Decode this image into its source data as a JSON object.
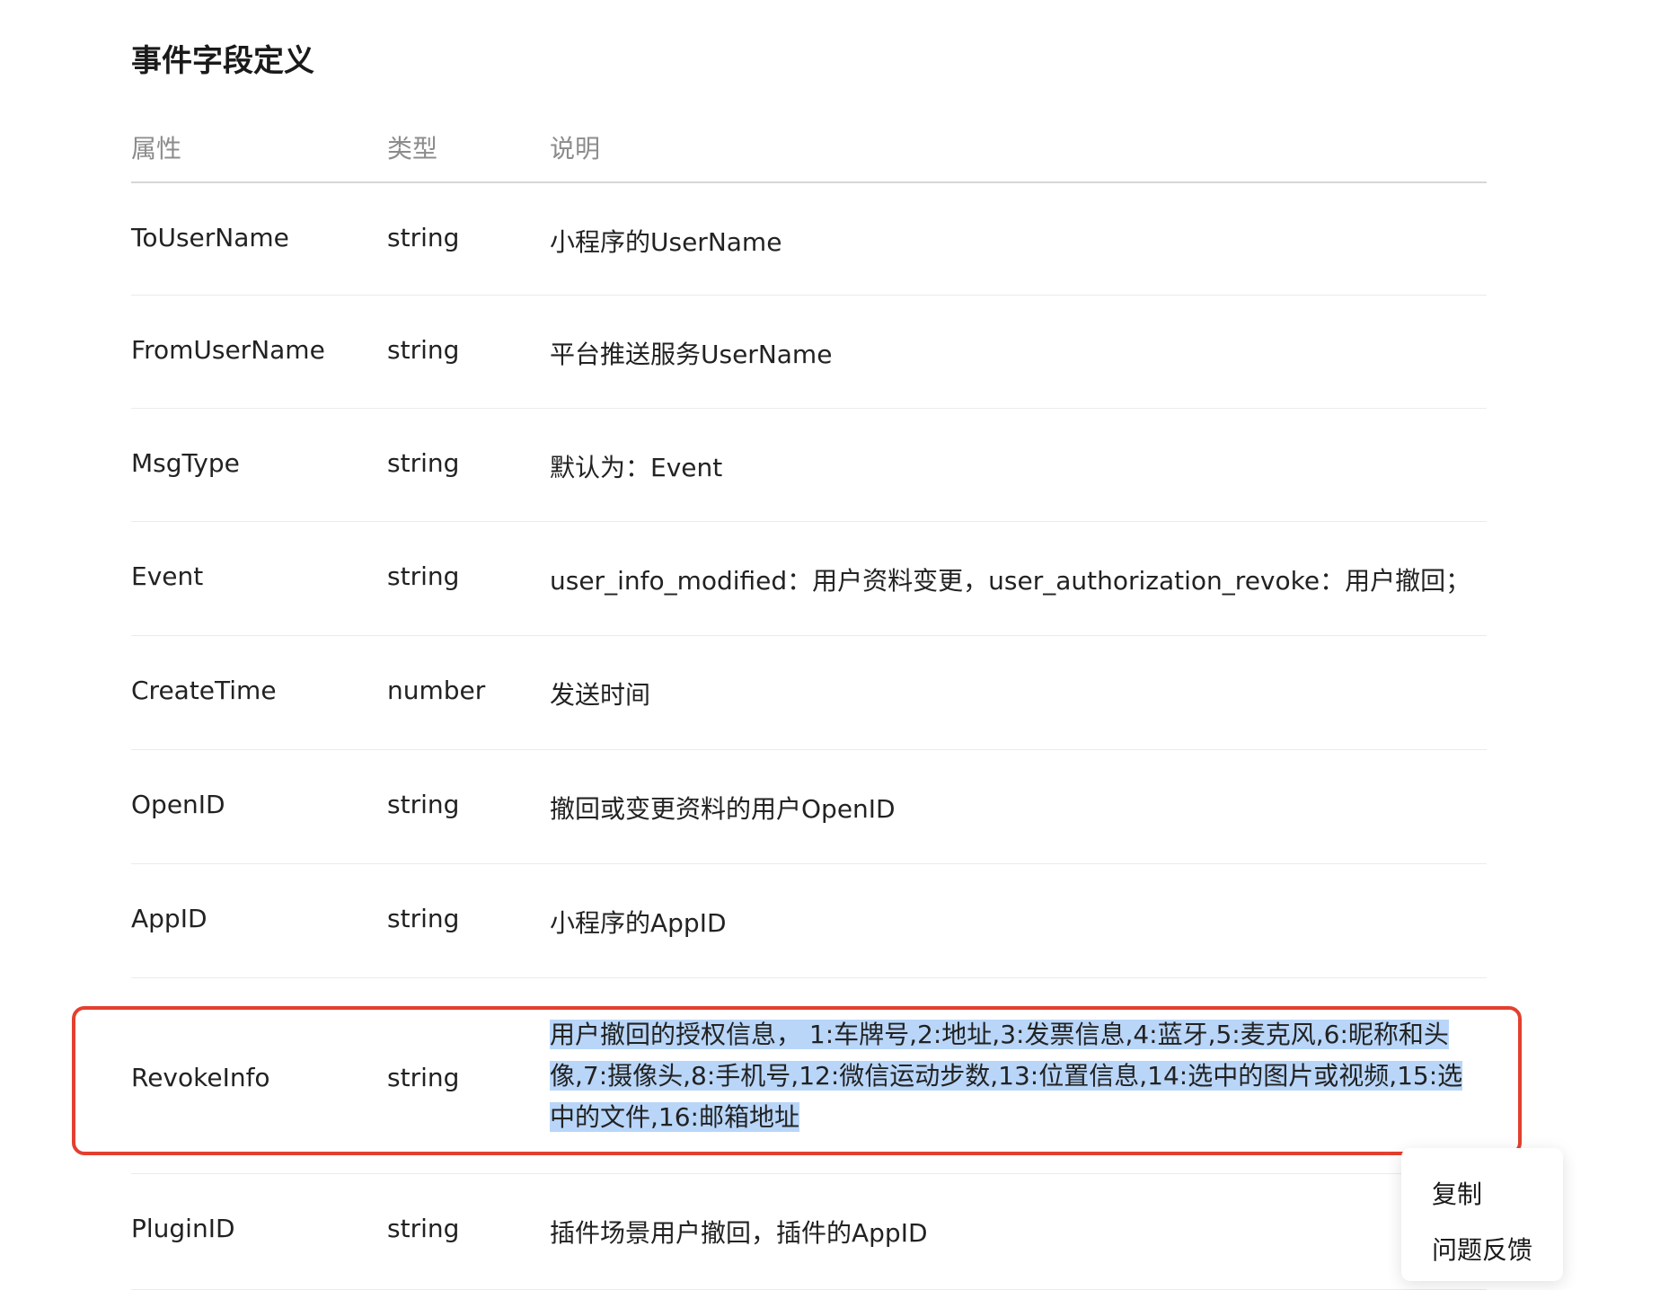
{
  "page": {
    "title": "事件字段定义"
  },
  "table": {
    "headers": [
      "属性",
      "类型",
      "说明"
    ],
    "rows": [
      {
        "name": "ToUserName",
        "type": "string",
        "desc": "小程序的UserName"
      },
      {
        "name": "FromUserName",
        "type": "string",
        "desc": "平台推送服务UserName"
      },
      {
        "name": "MsgType",
        "type": "string",
        "desc": "默认为：Event"
      },
      {
        "name": "Event",
        "type": "string",
        "desc": "user_info_modified：用户资料变更，user_authorization_revoke：用户撤回；"
      },
      {
        "name": "CreateTime",
        "type": "number",
        "desc": "发送时间"
      },
      {
        "name": "OpenID",
        "type": "string",
        "desc": "撤回或变更资料的用户OpenID"
      },
      {
        "name": "AppID",
        "type": "string",
        "desc": "小程序的AppID"
      },
      {
        "name": "RevokeInfo",
        "type": "string",
        "desc": "用户撤回的授权信息， 1:车牌号,2:地址,3:发票信息,4:蓝牙,5:麦克风,6:昵称和头像,7:摄像头,8:手机号,12:微信运动步数,13:位置信息,14:选中的图片或视频,15:选中的文件,16:邮箱地址"
      },
      {
        "name": "PluginID",
        "type": "string",
        "desc": "插件场景用户撤回，插件的AppID"
      }
    ]
  },
  "context_menu": {
    "items": [
      "复制",
      "问题反馈"
    ]
  },
  "colors": {
    "highlight_border": "#e3402f",
    "selection": "#b9d6f9"
  }
}
